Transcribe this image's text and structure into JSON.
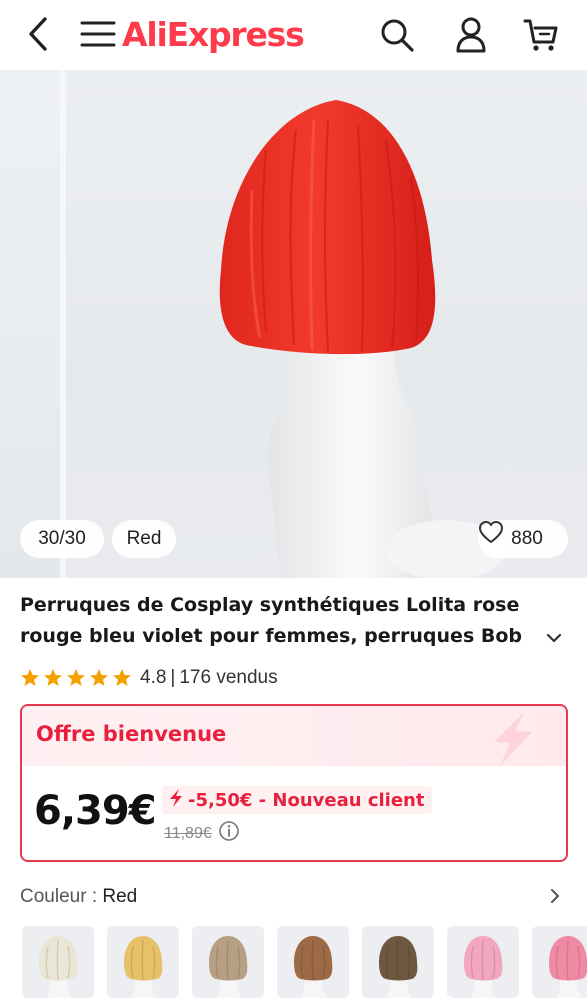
{
  "header": {
    "logo_text": "AliExpress",
    "brand_color": "#ff3a4a"
  },
  "gallery": {
    "counter": "30/30",
    "color_tag": "Red",
    "wish_count": "880"
  },
  "product": {
    "title": "Perruques de Cosplay synthétiques Lolita rose rouge bleu violet pour femmes, perruques Bob",
    "rating": "4.8",
    "sold": "176 vendus",
    "star_count": 5
  },
  "offer": {
    "title": "Offre bienvenue",
    "price": "6,39€",
    "discount": "-5,50€ - Nouveau client",
    "old_price": "11,89€",
    "accent_color": "#e8203e"
  },
  "color_selector": {
    "label": "Couleur",
    "value": "Red",
    "swatches": [
      {
        "name": "platinum",
        "color": "#eae6d6"
      },
      {
        "name": "golden",
        "color": "#e7c06a"
      },
      {
        "name": "ash-brown",
        "color": "#b79f84"
      },
      {
        "name": "brown",
        "color": "#9c6a44"
      },
      {
        "name": "dark-brown",
        "color": "#6f5840"
      },
      {
        "name": "pink",
        "color": "#f2a6bf"
      },
      {
        "name": "rose",
        "color": "#f08aa4"
      }
    ]
  }
}
